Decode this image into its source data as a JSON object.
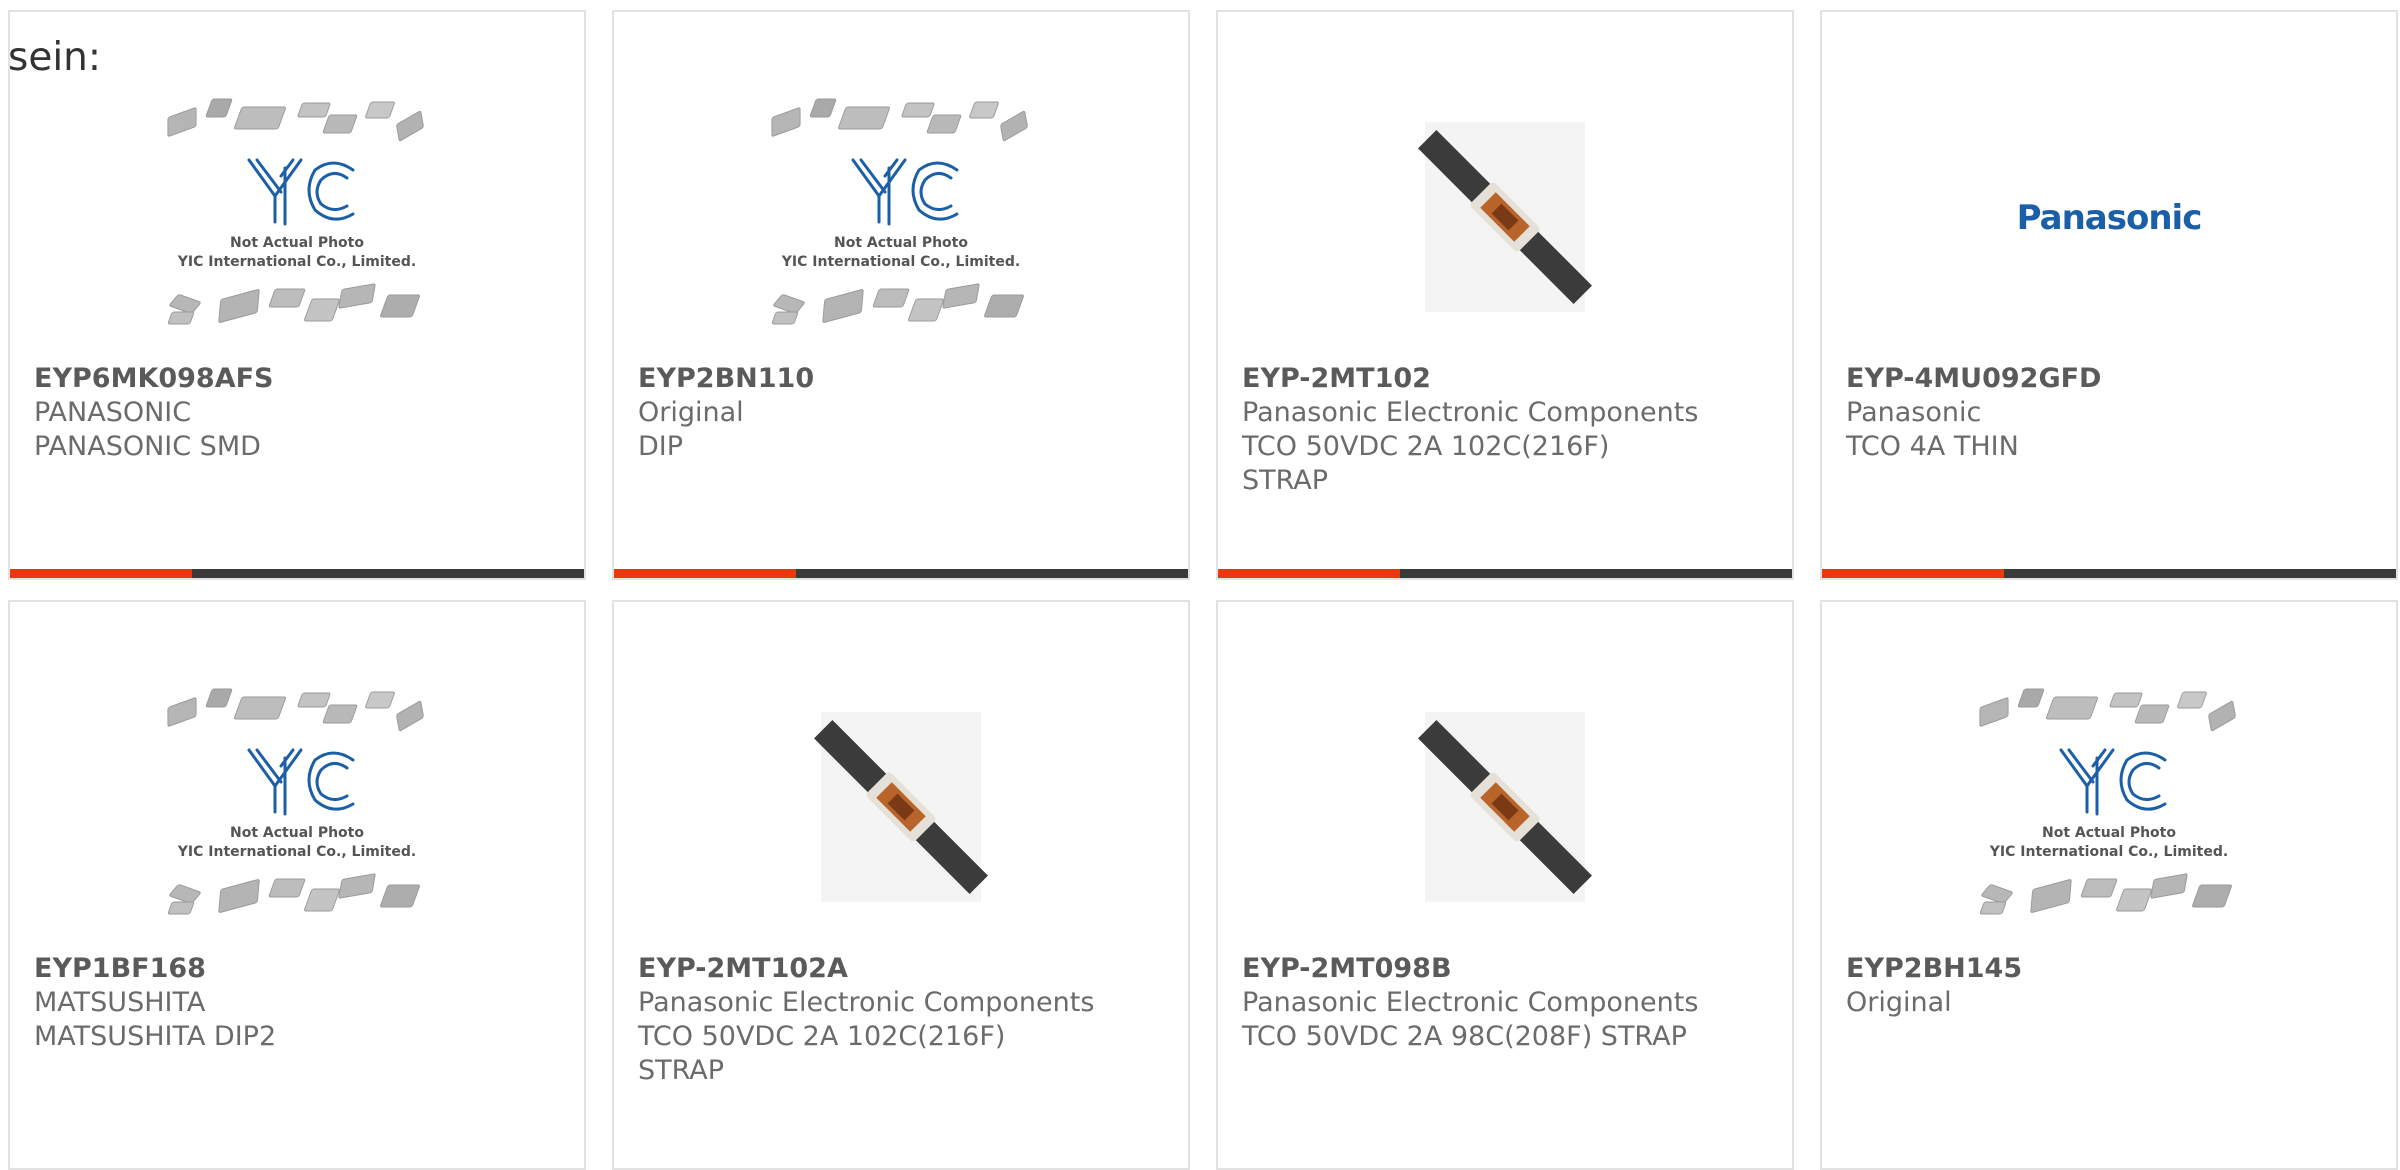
{
  "intro_text": "sein:",
  "placeholder": {
    "line1": "Not Actual Photo",
    "line2": "YIC International Co., Limited."
  },
  "brand_logo_text": "Panasonic",
  "colors": {
    "accent": "#e8380d",
    "bar": "#3a3a3a",
    "logo_blue": "#1b5fa8"
  },
  "products": [
    {
      "part": "EYP6MK098AFS",
      "lines": [
        "PANASONIC",
        "PANASONIC SMD"
      ],
      "image": "placeholder"
    },
    {
      "part": "EYP2BN110",
      "lines": [
        "Original",
        "DIP"
      ],
      "image": "placeholder"
    },
    {
      "part": "EYP-2MT102",
      "lines": [
        "Panasonic Electronic Components",
        "TCO 50VDC 2A 102C(216F)",
        "STRAP"
      ],
      "image": "strap"
    },
    {
      "part": "EYP-4MU092GFD",
      "lines": [
        "Panasonic",
        "TCO 4A THIN"
      ],
      "image": "logo"
    },
    {
      "part": "EYP1BF168",
      "lines": [
        "MATSUSHITA",
        "MATSUSHITA DIP2"
      ],
      "image": "placeholder"
    },
    {
      "part": "EYP-2MT102A",
      "lines": [
        "Panasonic Electronic Components",
        "TCO 50VDC 2A 102C(216F)",
        "STRAP"
      ],
      "image": "strap"
    },
    {
      "part": "EYP-2MT098B",
      "lines": [
        "Panasonic Electronic Components",
        "TCO 50VDC 2A 98C(208F) STRAP"
      ],
      "image": "strap"
    },
    {
      "part": "EYP2BH145",
      "lines": [
        "Original"
      ],
      "image": "placeholder"
    }
  ]
}
